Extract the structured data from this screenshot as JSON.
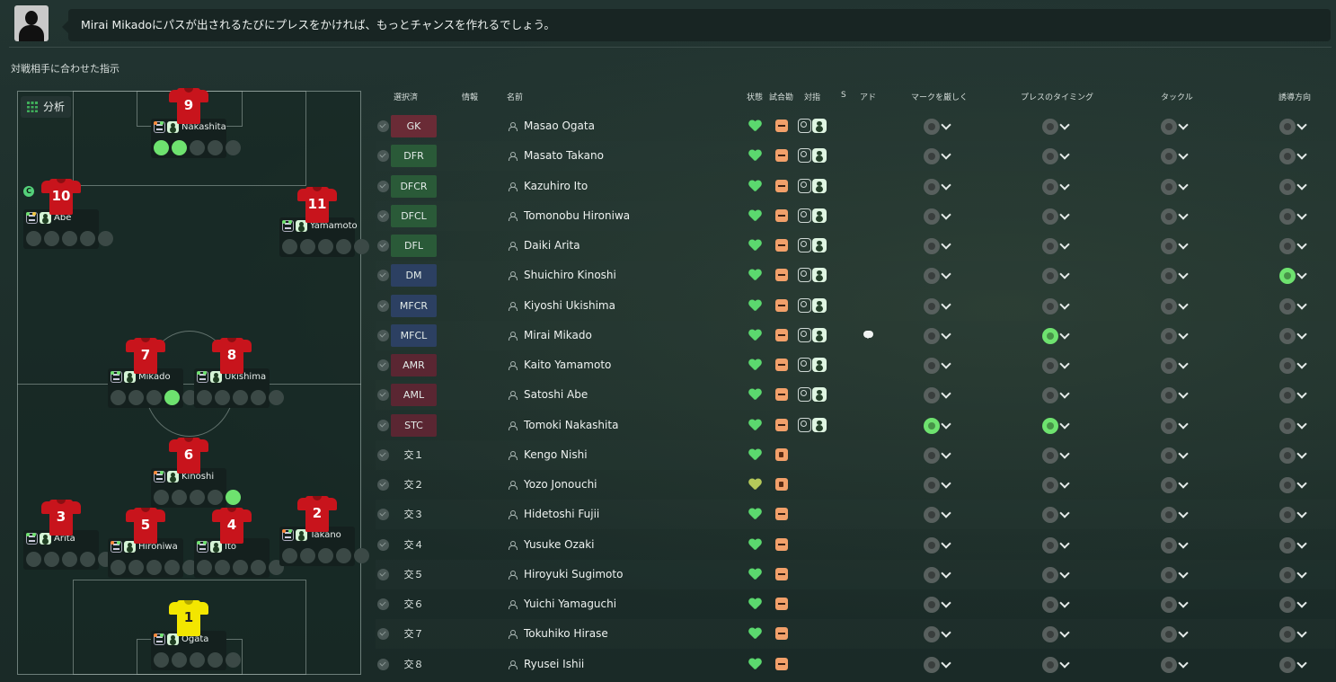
{
  "header": {
    "message": "Mirai Mikadoにパスが出されるたびにプレスをかければ、もっとチャンスを作れるでしょう。"
  },
  "section_title": "対戦相手に合わせた指示",
  "analysis_button": "分析",
  "pitch_players": [
    {
      "number": "9",
      "name": "Nakashita",
      "gk": false,
      "dots": [
        "o",
        "g"
      ]
    },
    {
      "number": "10",
      "name": "Abe",
      "gk": false,
      "dots": [
        "g",
        "y"
      ],
      "captain": "C"
    },
    {
      "number": "11",
      "name": "Yamamoto",
      "gk": false,
      "dots": [
        "g",
        "g"
      ]
    },
    {
      "number": "7",
      "name": "Mikado",
      "gk": false,
      "dots": [
        "g",
        "g"
      ]
    },
    {
      "number": "8",
      "name": "Ukishima",
      "gk": false,
      "dots": [
        "g",
        "g"
      ]
    },
    {
      "number": "6",
      "name": "Kinoshi",
      "gk": false,
      "dots": [
        "o",
        "g"
      ]
    },
    {
      "number": "3",
      "name": "Arita",
      "gk": false,
      "dots": [
        "g",
        "g"
      ]
    },
    {
      "number": "5",
      "name": "Hironiwa",
      "gk": false,
      "dots": [
        "o",
        "g"
      ]
    },
    {
      "number": "4",
      "name": "Ito",
      "gk": false,
      "dots": [
        "g",
        "g"
      ]
    },
    {
      "number": "2",
      "name": "Takano",
      "gk": false,
      "dots": [
        "o",
        "g"
      ]
    },
    {
      "number": "1",
      "name": "Ogata",
      "gk": true,
      "dots": [
        "o",
        "g"
      ]
    }
  ],
  "table": {
    "columns": {
      "selected": "選択済",
      "info": "情報",
      "name": "名前",
      "condition": "状態",
      "match_fitness": "試合勘",
      "opposition": "対指",
      "s": "S",
      "advice": "アド",
      "tight_marking": "マークを厳しく",
      "press_timing": "プレスのタイミング",
      "tackle": "タックル",
      "show_onto": "誘導方向"
    },
    "rows": [
      {
        "pos": "GK",
        "name": "Masao Ogata"
      },
      {
        "pos": "DFR",
        "name": "Masato Takano"
      },
      {
        "pos": "DFCR",
        "name": "Kazuhiro Ito"
      },
      {
        "pos": "DFCL",
        "name": "Tomonobu Hironiwa"
      },
      {
        "pos": "DFL",
        "name": "Daiki Arita"
      },
      {
        "pos": "DM",
        "name": "Shuichiro Kinoshi"
      },
      {
        "pos": "MFCR",
        "name": "Kiyoshi Ukishima"
      },
      {
        "pos": "MFCL",
        "name": "Mirai Mikado"
      },
      {
        "pos": "AMR",
        "name": "Kaito Yamamoto"
      },
      {
        "pos": "AML",
        "name": "Satoshi Abe"
      },
      {
        "pos": "STC",
        "name": "Tomoki Nakashita"
      },
      {
        "pos": "交１",
        "name": "Kengo Nishi"
      },
      {
        "pos": "交２",
        "name": "Yozo Jonouchi"
      },
      {
        "pos": "交３",
        "name": "Hidetoshi Fujii"
      },
      {
        "pos": "交４",
        "name": "Yusuke Ozaki"
      },
      {
        "pos": "交５",
        "name": "Hiroyuki Sugimoto"
      },
      {
        "pos": "交６",
        "name": "Yuichi Yamaguchi"
      },
      {
        "pos": "交７",
        "name": "Tokuhiko Hirase"
      },
      {
        "pos": "交８",
        "name": "Ryusei Ishii"
      }
    ]
  },
  "colors": {
    "accent_green": "#6ee26f",
    "gk_pos": "#6a2b36",
    "df_pos": "#2a5a38",
    "mf_pos": "#2c4062",
    "shirt_red": "#c8141c",
    "shirt_gk": "#f3e600"
  }
}
